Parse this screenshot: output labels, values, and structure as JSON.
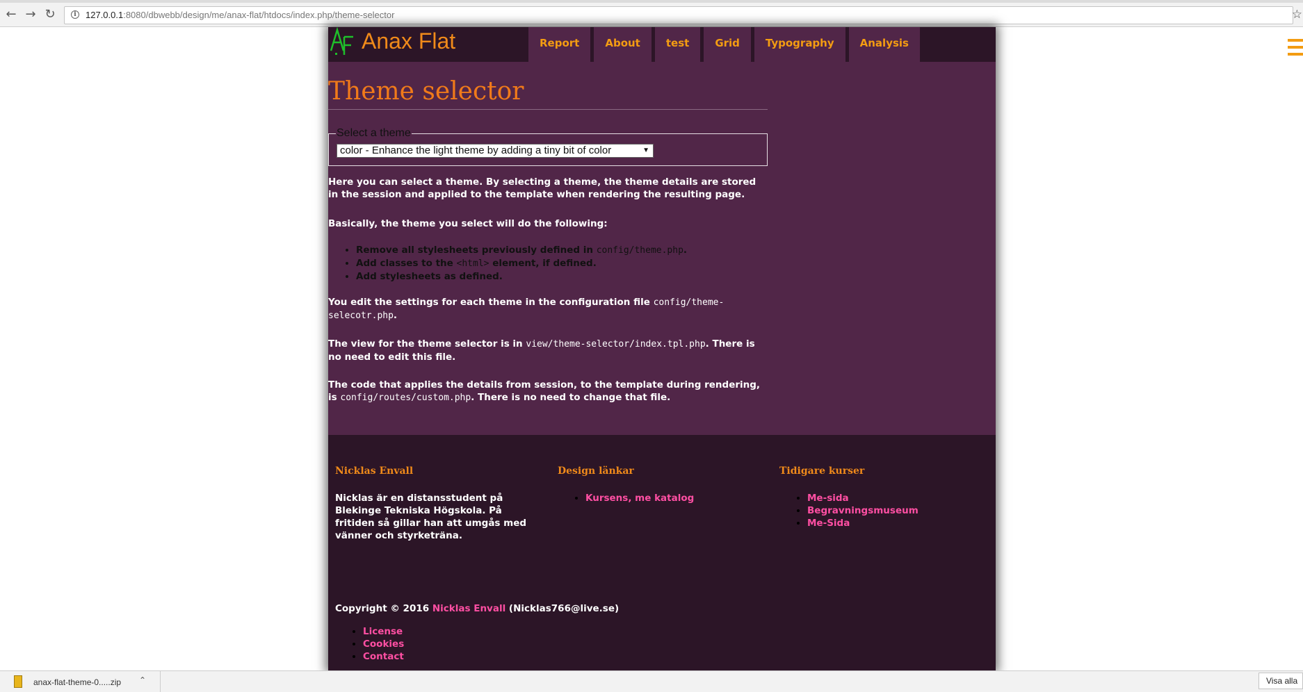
{
  "browser": {
    "url_host": "127.0.0.1",
    "url_rest": ":8080/dbwebb/design/me/anax-flat/htdocs/index.php/theme-selector"
  },
  "header": {
    "logo_text": "AF",
    "site_title": "Anax Flat",
    "nav": [
      "Report",
      "About",
      "test",
      "Grid",
      "Typography",
      "Analysis"
    ]
  },
  "main": {
    "title": "Theme selector",
    "fieldset_legend": "Select a theme",
    "select_value": "color - Enhance the light theme by adding a tiny bit of color",
    "para1": "Here you can select a theme. By selecting a theme, the theme details are stored in the session and applied to the template when rendering the resulting page.",
    "para2": "Basically, the theme you select will do the following:",
    "bullet1_text": "Remove all stylesheets previously defined in ",
    "bullet1_code": "config/theme.php",
    "bullet1_end": ".",
    "bullet2_text": "Add classes to the ",
    "bullet2_code": "<html>",
    "bullet2_end": " element, if defined.",
    "bullet3_text": "Add stylesheets as defined.",
    "para3_text": "You edit the settings for each theme in the configuration file ",
    "para3_code": "config/theme-selecotr.php",
    "para3_end": ".",
    "para4_text": "The view for the theme selector is in ",
    "para4_code": "view/theme-selector/index.tpl.php",
    "para4_end": ". There is no need to edit this file.",
    "para5_text": "The code that applies the details from session, to the template during rendering, is ",
    "para5_code": "config/routes/custom.php",
    "para5_end": ". There is no need to change that file."
  },
  "footer": {
    "col1_title": "Nicklas Envall",
    "col1_text": "Nicklas är en distansstudent på Blekinge Tekniska Högskola. På fritiden så gillar han att umgås med vänner och styrketräna.",
    "col2_title": "Design länkar",
    "col2_links": [
      "Kursens, me katalog"
    ],
    "col3_title": "Tidigare kurser",
    "col3_links": [
      "Me-sida",
      "Begravningsmuseum",
      "Me-Sida"
    ],
    "copyright_prefix": "Copyright © 2016 ",
    "copyright_name": "Nicklas Envall",
    "copyright_suffix": " (Nicklas766@live.se)",
    "bottom_links": [
      "License",
      "Cookies",
      "Contact"
    ]
  },
  "download_bar": {
    "file_name": "anax-flat-theme-0.....zip",
    "show_all": "Visa alla"
  },
  "colors": {
    "page_bg": "#512648",
    "header_footer_bg": "#2c1527",
    "accent_orange": "#f39c12",
    "link_pink": "#ff4fa3",
    "logo_green": "#1fbf2a"
  }
}
